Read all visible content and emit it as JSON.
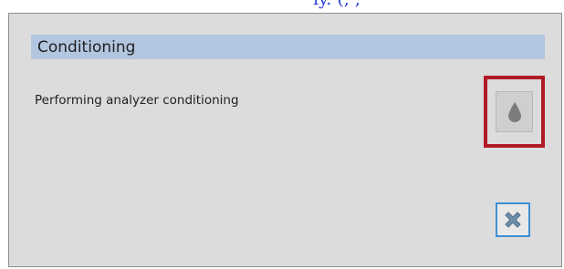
{
  "top_fragment": "ıy. (, ,",
  "dialog": {
    "title": "Conditioning",
    "status": "Performing analyzer conditioning"
  },
  "icons": {
    "drop": "drop-icon",
    "close": "close-icon"
  },
  "colors": {
    "header_bar": "#b3c6e0",
    "highlight_border": "#b01c25",
    "close_border": "#3f8fd6",
    "close_x": "#6e8faa"
  }
}
